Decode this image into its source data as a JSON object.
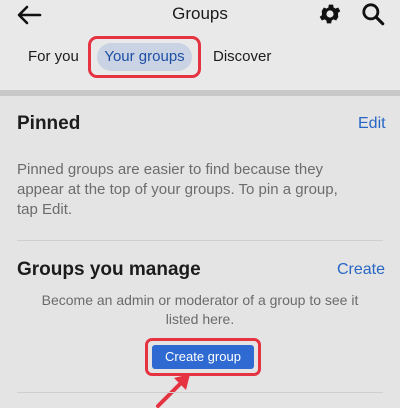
{
  "header": {
    "title": "Groups",
    "back_icon": "arrow-left-icon",
    "settings_icon": "gear-icon",
    "search_icon": "search-icon"
  },
  "tabs": [
    {
      "label": "For you",
      "selected": false
    },
    {
      "label": "Your groups",
      "selected": true
    },
    {
      "label": "Discover",
      "selected": false
    }
  ],
  "pinned": {
    "title": "Pinned",
    "action": "Edit",
    "description_lines": [
      "Pinned groups are easier to find because they",
      "appear at the top of your groups. To pin a group,",
      "tap Edit."
    ]
  },
  "manage": {
    "title": "Groups you manage",
    "action": "Create",
    "description_lines": [
      "Become an admin or moderator of a group to see it",
      "listed here."
    ],
    "button_label": "Create group"
  },
  "colors": {
    "accent": "#2866c5",
    "highlight": "#e53342",
    "button": "#2f6ad3"
  }
}
